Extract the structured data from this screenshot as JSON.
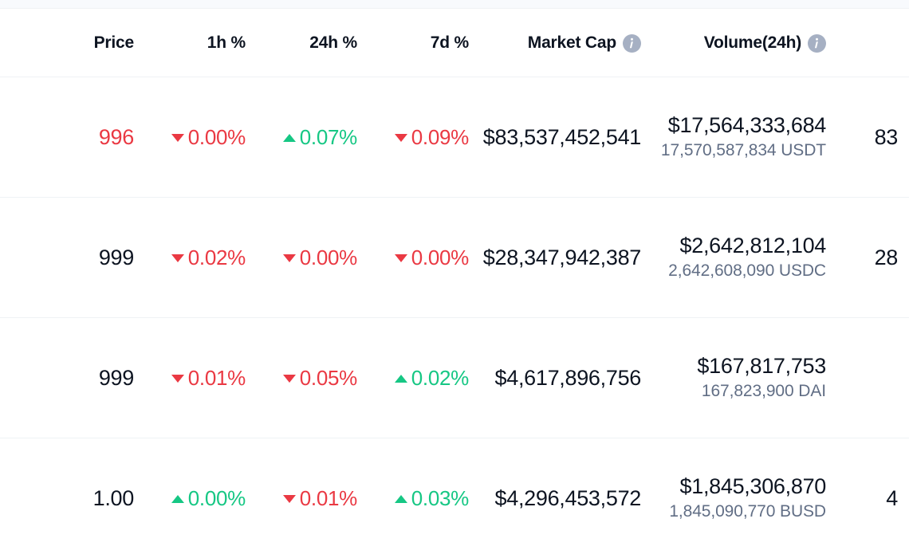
{
  "table": {
    "columns": [
      {
        "key": "price",
        "label": "Price",
        "info": false
      },
      {
        "key": "h1",
        "label": "1h %",
        "info": false
      },
      {
        "key": "h24",
        "label": "24h %",
        "info": false
      },
      {
        "key": "d7",
        "label": "7d %",
        "info": false
      },
      {
        "key": "mcap",
        "label": "Market Cap",
        "info": true,
        "info_icon": "info-icon"
      },
      {
        "key": "volume",
        "label": "Volume(24h)",
        "info": true,
        "info_icon": "info-icon"
      },
      {
        "key": "supply",
        "label": "",
        "info": false
      }
    ],
    "rows": [
      {
        "price": "996",
        "price_dir": "down",
        "h1": {
          "value": "0.00%",
          "dir": "down",
          "icon": "caret-down-icon"
        },
        "h24": {
          "value": "0.07%",
          "dir": "up",
          "icon": "caret-up-icon"
        },
        "d7": {
          "value": "0.09%",
          "dir": "down",
          "icon": "caret-down-icon"
        },
        "market_cap": "$83,537,452,541",
        "volume_usd": "$17,564,333,684",
        "volume_native": "17,570,587,834 USDT",
        "supply": "83"
      },
      {
        "price": "999",
        "price_dir": "neutral",
        "h1": {
          "value": "0.02%",
          "dir": "down",
          "icon": "caret-down-icon"
        },
        "h24": {
          "value": "0.00%",
          "dir": "down",
          "icon": "caret-down-icon"
        },
        "d7": {
          "value": "0.00%",
          "dir": "down",
          "icon": "caret-down-icon"
        },
        "market_cap": "$28,347,942,387",
        "volume_usd": "$2,642,812,104",
        "volume_native": "2,642,608,090 USDC",
        "supply": "28"
      },
      {
        "price": "999",
        "price_dir": "neutral",
        "h1": {
          "value": "0.01%",
          "dir": "down",
          "icon": "caret-down-icon"
        },
        "h24": {
          "value": "0.05%",
          "dir": "down",
          "icon": "caret-down-icon"
        },
        "d7": {
          "value": "0.02%",
          "dir": "up",
          "icon": "caret-up-icon"
        },
        "market_cap": "$4,617,896,756",
        "volume_usd": "$167,817,753",
        "volume_native": "167,823,900 DAI",
        "supply": ""
      },
      {
        "price": "1.00",
        "price_dir": "neutral",
        "h1": {
          "value": "0.00%",
          "dir": "up",
          "icon": "caret-up-icon"
        },
        "h24": {
          "value": "0.01%",
          "dir": "down",
          "icon": "caret-down-icon"
        },
        "d7": {
          "value": "0.03%",
          "dir": "up",
          "icon": "caret-up-icon"
        },
        "market_cap": "$4,296,453,572",
        "volume_usd": "$1,845,306,870",
        "volume_native": "1,845,090,770 BUSD",
        "supply": "4"
      }
    ]
  },
  "colors": {
    "up": "#16c784",
    "down": "#ea3943",
    "text": "#0d1421",
    "muted": "#616e85",
    "divider": "#eff2f5",
    "info_icon": "#a6b0c3"
  }
}
